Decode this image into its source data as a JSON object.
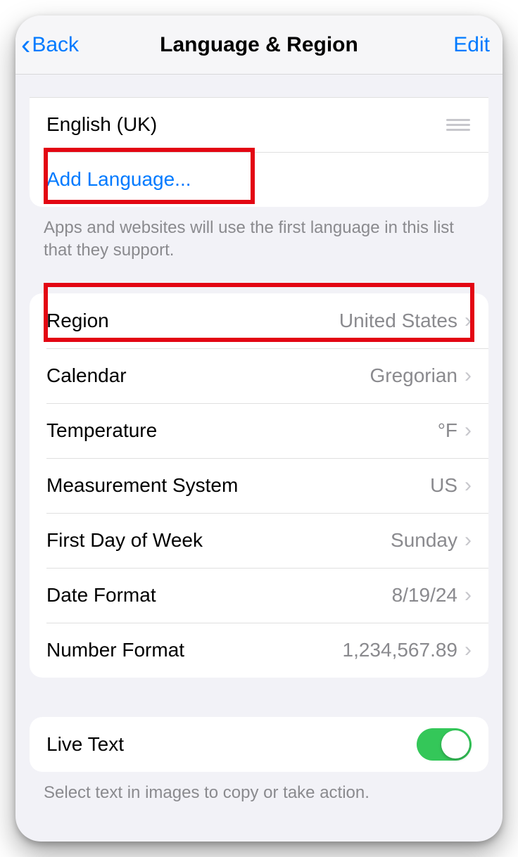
{
  "nav": {
    "back_label": "Back",
    "title": "Language & Region",
    "edit_label": "Edit"
  },
  "languages_section": {
    "items": [
      {
        "name": "English (UK)"
      }
    ],
    "add_label": "Add Language...",
    "footer": "Apps and websites will use the first language in this list that they support."
  },
  "settings_section": {
    "rows": [
      {
        "label": "Region",
        "value": "United States"
      },
      {
        "label": "Calendar",
        "value": "Gregorian"
      },
      {
        "label": "Temperature",
        "value": "°F"
      },
      {
        "label": "Measurement System",
        "value": "US"
      },
      {
        "label": "First Day of Week",
        "value": "Sunday"
      },
      {
        "label": "Date Format",
        "value": "8/19/24"
      },
      {
        "label": "Number Format",
        "value": "1,234,567.89"
      }
    ]
  },
  "live_text_section": {
    "label": "Live Text",
    "enabled": true,
    "footer": "Select text in images to copy or take action."
  },
  "annotations": {
    "highlight_add_language": true,
    "highlight_region_row": true
  }
}
